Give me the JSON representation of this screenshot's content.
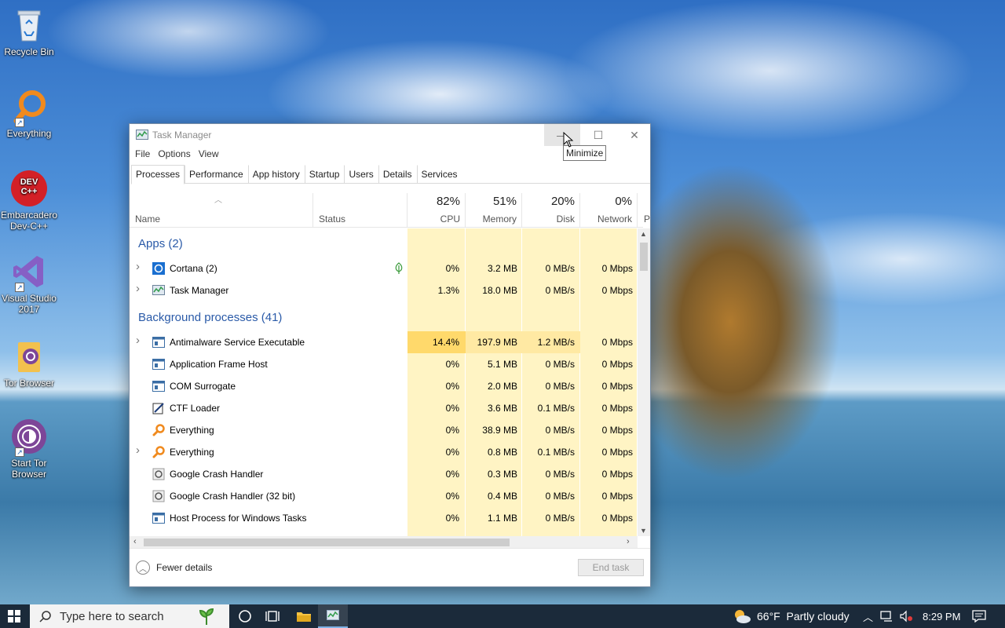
{
  "desktop": {
    "icons": [
      {
        "label": "Recycle Bin"
      },
      {
        "label": "Everything"
      },
      {
        "label": "Embarcadero Dev-C++",
        "badge": "DEV C++"
      },
      {
        "label": "Visual Studio 2017"
      },
      {
        "label": "Tor Browser"
      },
      {
        "label": "Start Tor Browser"
      }
    ]
  },
  "window": {
    "title": "Task Manager",
    "tooltip": "Minimize",
    "menu": [
      "File",
      "Options",
      "View"
    ],
    "tabs": [
      "Processes",
      "Performance",
      "App history",
      "Startup",
      "Users",
      "Details",
      "Services"
    ],
    "active_tab": "Processes",
    "columns": {
      "name": "Name",
      "status": "Status",
      "cpu": {
        "pct": "82%",
        "label": "CPU"
      },
      "memory": {
        "pct": "51%",
        "label": "Memory"
      },
      "disk": {
        "pct": "20%",
        "label": "Disk"
      },
      "network": {
        "pct": "0%",
        "label": "Network"
      },
      "more": "P"
    },
    "groups": {
      "apps": "Apps (2)",
      "background": "Background processes (41)"
    },
    "apps": [
      {
        "name": "Cortana (2)",
        "cpu": "0%",
        "memory": "3.2 MB",
        "disk": "0 MB/s",
        "network": "0 Mbps",
        "expandable": true,
        "icon": "cortana-icon",
        "leaf": true
      },
      {
        "name": "Task Manager",
        "cpu": "1.3%",
        "memory": "18.0 MB",
        "disk": "0 MB/s",
        "network": "0 Mbps",
        "expandable": true,
        "icon": "task-manager-icon"
      }
    ],
    "background": [
      {
        "name": "Antimalware Service Executable",
        "cpu": "14.4%",
        "memory": "197.9 MB",
        "disk": "1.2 MB/s",
        "network": "0 Mbps",
        "expandable": true,
        "icon": "window-app-icon",
        "hot": true
      },
      {
        "name": "Application Frame Host",
        "cpu": "0%",
        "memory": "5.1 MB",
        "disk": "0 MB/s",
        "network": "0 Mbps",
        "icon": "window-app-icon"
      },
      {
        "name": "COM Surrogate",
        "cpu": "0%",
        "memory": "2.0 MB",
        "disk": "0 MB/s",
        "network": "0 Mbps",
        "icon": "window-app-icon"
      },
      {
        "name": "CTF Loader",
        "cpu": "0%",
        "memory": "3.6 MB",
        "disk": "0.1 MB/s",
        "network": "0 Mbps",
        "icon": "ctf-icon"
      },
      {
        "name": "Everything",
        "cpu": "0%",
        "memory": "38.9 MB",
        "disk": "0 MB/s",
        "network": "0 Mbps",
        "icon": "everything-icon"
      },
      {
        "name": "Everything",
        "cpu": "0%",
        "memory": "0.8 MB",
        "disk": "0.1 MB/s",
        "network": "0 Mbps",
        "expandable": true,
        "icon": "everything-icon"
      },
      {
        "name": "Google Crash Handler",
        "cpu": "0%",
        "memory": "0.3 MB",
        "disk": "0 MB/s",
        "network": "0 Mbps",
        "icon": "google-icon"
      },
      {
        "name": "Google Crash Handler (32 bit)",
        "cpu": "0%",
        "memory": "0.4 MB",
        "disk": "0 MB/s",
        "network": "0 Mbps",
        "icon": "google-icon"
      },
      {
        "name": "Host Process for Windows Tasks",
        "cpu": "0%",
        "memory": "1.1 MB",
        "disk": "0 MB/s",
        "network": "0 Mbps",
        "icon": "window-app-icon"
      }
    ],
    "footer": {
      "fewer_details": "Fewer details",
      "end_task": "End task"
    }
  },
  "taskbar": {
    "search_placeholder": "Type here to search",
    "weather": "66°F  Partly cloudy",
    "time": "8:29 PM"
  },
  "colors": {
    "accent": "#2a5aa8",
    "cpu_cell": "#fff4c4",
    "cpu_hot": "#ffe9a3",
    "taskbar": "#1b2a3a"
  }
}
